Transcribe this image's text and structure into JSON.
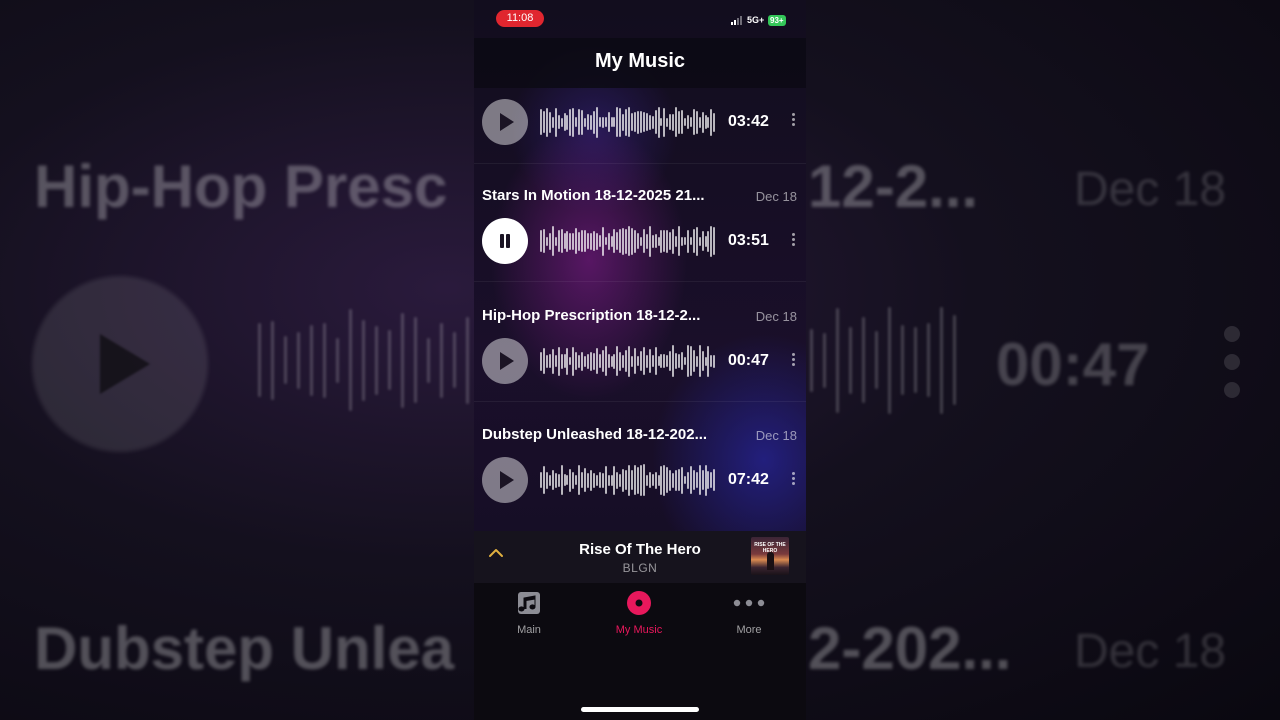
{
  "status_bar": {
    "time": "11:08",
    "network": "5G+",
    "battery": "93+"
  },
  "header": {
    "title": "My Music"
  },
  "tracks": [
    {
      "title": "",
      "date": "",
      "duration": "03:42",
      "state": "paused"
    },
    {
      "title": "Stars In Motion 18-12-2025 21...",
      "date": "Dec 18",
      "duration": "03:51",
      "state": "playing"
    },
    {
      "title": "Hip-Hop Prescription 18-12-2...",
      "date": "Dec 18",
      "duration": "00:47",
      "state": "paused"
    },
    {
      "title": "Dubstep Unleashed 18-12-202...",
      "date": "Dec 18",
      "duration": "07:42",
      "state": "paused"
    }
  ],
  "mini_player": {
    "title": "Rise Of The Hero",
    "artist": "BLGN",
    "artwork_text": "RISE OF THE HERO"
  },
  "tab_bar": {
    "tabs": [
      {
        "label": "Main",
        "icon": "music-note-icon",
        "active": false
      },
      {
        "label": "My Music",
        "icon": "disc-icon",
        "active": true
      },
      {
        "label": "More",
        "icon": "more-dots-icon",
        "active": false
      }
    ]
  },
  "background": {
    "line1": "Hip-Hop Presc",
    "line1_right": "12-2...",
    "date1": "Dec 18",
    "duration": "00:47",
    "line2": "Dubstep Unlea",
    "line2_right": "2-202...",
    "date2": "Dec 18"
  },
  "colors": {
    "accent": "#e8185c",
    "time_pill": "#e0262f",
    "battery": "#34c759",
    "chevron": "#e0b040"
  }
}
